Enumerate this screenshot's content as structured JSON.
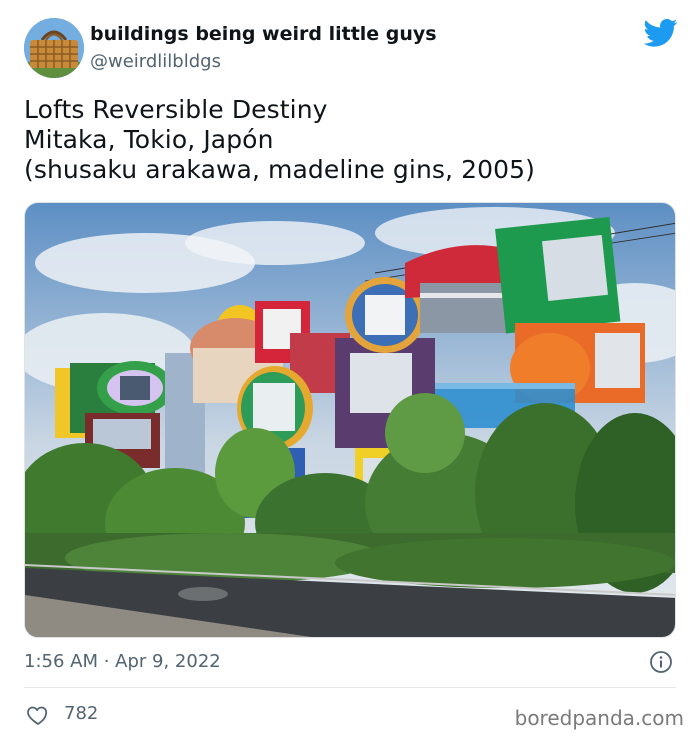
{
  "author": {
    "display_name": "buildings being weird little guys",
    "handle": "@weirdlilbldgs",
    "avatar_icon": "basket-building-avatar"
  },
  "brand": {
    "icon": "twitter-bird-icon",
    "color": "#1d9bf0"
  },
  "tweet": {
    "lines": [
      "Lofts Reversible Destiny",
      "Mitaka, Tokio, Japón",
      "(shusaku arakawa, madeline gins, 2005)"
    ],
    "timestamp": "1:56 AM · Apr 9, 2022"
  },
  "stats": {
    "likes": "782",
    "like_icon": "heart-icon",
    "info_icon": "info-icon"
  },
  "watermark": "boredpanda.com"
}
